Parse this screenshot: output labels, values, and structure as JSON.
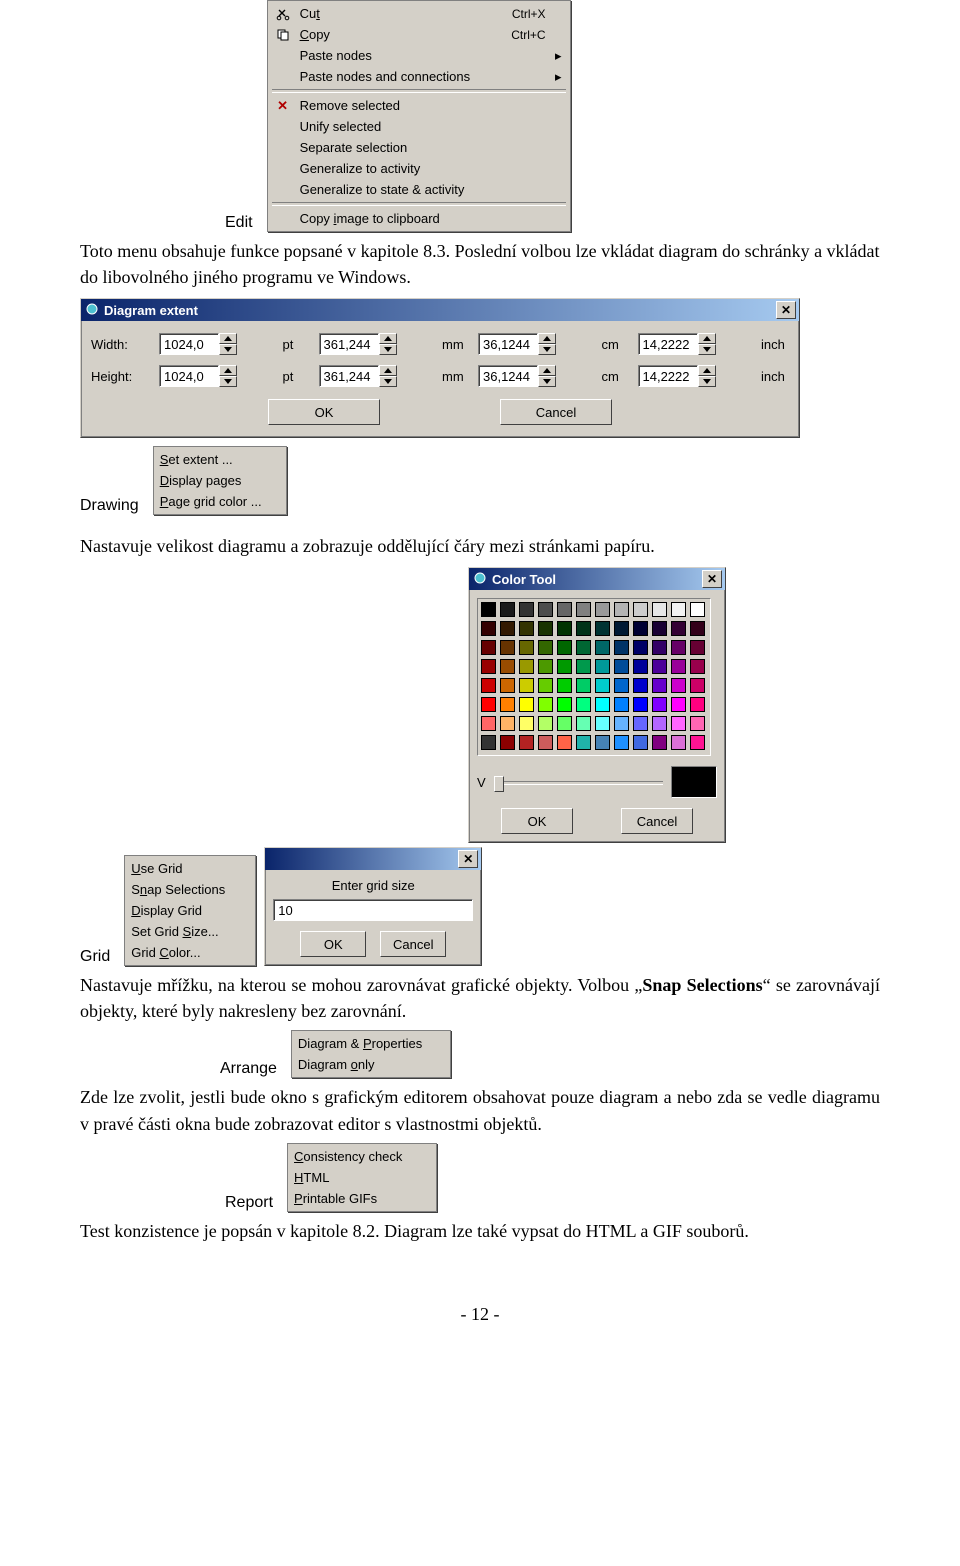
{
  "labels": {
    "edit": "Edit",
    "drawing": "Drawing",
    "grid": "Grid",
    "arrange": "Arrange",
    "report": "Report"
  },
  "edit_menu": {
    "cut": "Cut",
    "cut_sc": "Ctrl+X",
    "copy": "Copy",
    "copy_sc": "Ctrl+C",
    "paste_nodes": "Paste nodes",
    "paste_nodes_conn": "Paste nodes and connections",
    "remove": "Remove selected",
    "unify": "Unify selected",
    "separate": "Separate selection",
    "gen_activity": "Generalize to activity",
    "gen_state": "Generalize to state & activity",
    "copy_img": "Copy image to clipboard",
    "cut_u": "t",
    "copy_u": "C",
    "copy_img_u": "i"
  },
  "para1": "Toto menu obsahuje funkce popsané v kapitole 8.3. Poslední volbou lze vkládat diagram do schránky a vkládat do libovolného jiného programu ve Windows.",
  "diagram_extent": {
    "title": "Diagram extent",
    "width_lbl": "Width:",
    "height_lbl": "Height:",
    "pt": "pt",
    "mm": "mm",
    "cm": "cm",
    "inch": "inch",
    "w_pt": "1024,0",
    "w_mm": "361,244",
    "w_cm": "36,1244",
    "w_inch": "14,2222",
    "h_pt": "1024,0",
    "h_mm": "361,244",
    "h_cm": "36,1244",
    "h_inch": "14,2222",
    "ok": "OK",
    "cancel": "Cancel"
  },
  "drawing_menu": {
    "set_extent": "Set extent ...",
    "display_pages": "Display pages",
    "grid_color": "Page grid color ..."
  },
  "para2": "Nastavuje velikost diagramu a zobrazuje oddělující čáry mezi stránkami papíru.",
  "color_tool": {
    "title": "Color Tool",
    "v": "V",
    "ok": "OK",
    "cancel": "Cancel",
    "rows": [
      [
        "#000000",
        "#1a1a1a",
        "#333333",
        "#4d4d4d",
        "#666666",
        "#808080",
        "#999999",
        "#b3b3b3",
        "#cccccc",
        "#e6e6e6",
        "#f2f2f2",
        "#ffffff"
      ],
      [
        "#330000",
        "#331900",
        "#333300",
        "#193300",
        "#003300",
        "#003319",
        "#003333",
        "#001933",
        "#000033",
        "#190033",
        "#330033",
        "#330019"
      ],
      [
        "#660000",
        "#663300",
        "#666600",
        "#336600",
        "#006600",
        "#006633",
        "#006666",
        "#003366",
        "#000066",
        "#330066",
        "#660066",
        "#660033"
      ],
      [
        "#990000",
        "#994c00",
        "#999900",
        "#4c9900",
        "#009900",
        "#00994c",
        "#009999",
        "#004c99",
        "#000099",
        "#4c0099",
        "#990099",
        "#99004c"
      ],
      [
        "#cc0000",
        "#cc6600",
        "#cccc00",
        "#66cc00",
        "#00cc00",
        "#00cc66",
        "#00cccc",
        "#0066cc",
        "#0000cc",
        "#6600cc",
        "#cc00cc",
        "#cc0066"
      ],
      [
        "#ff0000",
        "#ff8000",
        "#ffff00",
        "#80ff00",
        "#00ff00",
        "#00ff80",
        "#00ffff",
        "#0080ff",
        "#0000ff",
        "#8000ff",
        "#ff00ff",
        "#ff0080"
      ],
      [
        "#ff6666",
        "#ffb366",
        "#ffff66",
        "#b3ff66",
        "#66ff66",
        "#66ffb3",
        "#66ffff",
        "#66b3ff",
        "#6666ff",
        "#b366ff",
        "#ff66ff",
        "#ff66b3"
      ],
      [
        "#333333",
        "#8b0000",
        "#b22222",
        "#cd5c5c",
        "#ff6347",
        "#20b2aa",
        "#4682b4",
        "#1e90ff",
        "#4169e1",
        "#800080",
        "#da70d6",
        "#ff1493"
      ]
    ]
  },
  "grid_menu": {
    "use": "Use Grid",
    "snap": "Snap Selections",
    "display": "Display Grid",
    "size": "Set Grid Size...",
    "color": "Grid Color..."
  },
  "grid_size_dlg": {
    "label": "Enter grid size",
    "value": "10",
    "ok": "OK",
    "cancel": "Cancel"
  },
  "para3": "Nastavuje mřížku, na kterou se mohou zarovnávat grafické objekty. Volbou „Snap Selections“ se zarovnávají objekty, které byly nakresleny bez zarovnání.",
  "arrange_menu": {
    "both": "Diagram & Properties",
    "only": "Diagram only"
  },
  "para4": "Zde lze zvolit, jestli bude okno s grafickým editorem obsahovat pouze diagram a nebo zda se vedle diagramu v pravé části okna bude zobrazovat editor s vlastnostmi objektů.",
  "report_menu": {
    "check": "Consistency check",
    "html": "HTML",
    "gif": "Printable GIFs"
  },
  "para5": "Test konzistence je popsán v kapitole 8.2. Diagram lze také vypsat do HTML a GIF souborů.",
  "page_num": "- 12 -"
}
